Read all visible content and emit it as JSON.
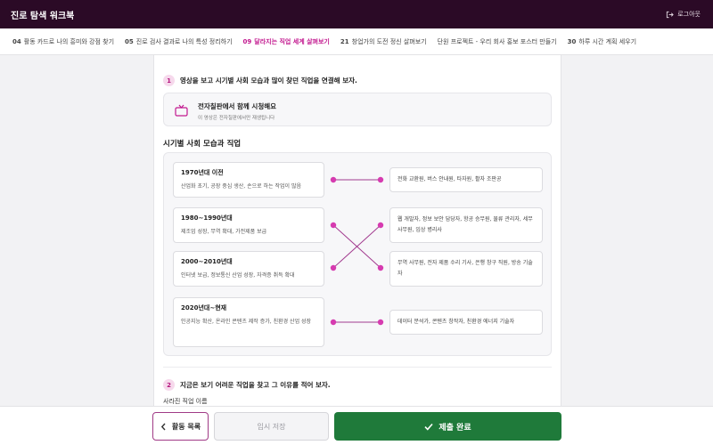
{
  "app": {
    "title": "진로 탐색 워크북",
    "logout_label": "로그아웃"
  },
  "tabs": [
    {
      "num": "04",
      "label": "활동 카드로 나의 흥미와 강점 찾기",
      "active": false
    },
    {
      "num": "05",
      "label": "진로 검사 결과로 나의 특성 정리하기",
      "active": false
    },
    {
      "num": "09",
      "label": "달라지는 직업 세계 살펴보기",
      "active": true
    },
    {
      "num": "21",
      "label": "창업가의 도전 정신 살펴보기",
      "active": false
    },
    {
      "num": "",
      "label": "단원 프로젝트 - 우리 회사 홍보 포스터 만들기",
      "active": false
    },
    {
      "num": "30",
      "label": "하루 시간 계획 세우기",
      "active": false
    }
  ],
  "q1": {
    "num": "1",
    "text": "영상을 보고 시기별 사회 모습과 많이 찾던 직업을 연결해 보자.",
    "video": {
      "title": "전자칠판에서 함께 시청해요",
      "subtitle": "이 영상은 전자칠판에서만 재생됩니다"
    }
  },
  "section_title": "시기별 사회 모습과 직업",
  "eras": [
    {
      "title": "1970년대 이전",
      "desc": "산업화 초기, 공장 중심 생산, 손으로 하는 작업이 많음"
    },
    {
      "title": "1980~1990년대",
      "desc": "제조업 성장, 무역 확대, 가전제품 보급"
    },
    {
      "title": "2000~2010년대",
      "desc": "인터넷 보급, 정보통신 산업 성장, 자격증 취득 확대"
    },
    {
      "title": "2020년대~현재",
      "desc": "인공지능 확산, 온라인 콘텐츠 제작 증가, 친환경 산업 성장"
    }
  ],
  "jobs": [
    {
      "text": "전화 교환원, 버스 안내원, 타자원, 활자 조판공"
    },
    {
      "text": "웹 개발자, 정보 보안 담당자, 항공 승무원, 물류 관리자, 세무 사무원, 임상 병리사"
    },
    {
      "text": "무역 사무원, 전자 제품 수리 기사, 은행 창구 직원, 방송 기술자"
    },
    {
      "text": "데이터 분석가, 콘텐츠 창작자, 친환경 에너지 기술자"
    }
  ],
  "connections": [
    {
      "era": 0,
      "job": 0
    },
    {
      "era": 1,
      "job": 2
    },
    {
      "era": 2,
      "job": 1
    },
    {
      "era": 3,
      "job": 3
    }
  ],
  "q2": {
    "num": "2",
    "text": "지금은 보기 어려운 직업을 찾고 그 이유를 적어 보자.",
    "sub": "사라진 직업 이름"
  },
  "footer": {
    "back_label": "활동 목록",
    "save_label": "임시 저장",
    "submit_label": "제출 완료"
  },
  "colors": {
    "accent": "#c2188f",
    "connector": "#d63bb0",
    "submit": "#1f7a3a",
    "topbar": "#2b0a26"
  },
  "icons": {
    "logout": "logout-icon",
    "tv": "tv-icon",
    "back": "chevron-left-icon",
    "submit": "check-icon"
  }
}
